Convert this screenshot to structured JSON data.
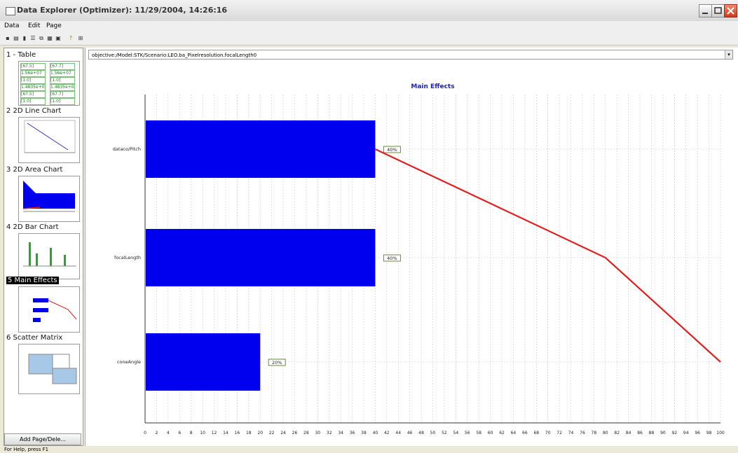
{
  "window": {
    "title": "Data Explorer (Optimizer): 11/29/2004, 14:26:16"
  },
  "menu": [
    "Data",
    "Edit",
    "Page"
  ],
  "toolbar": {
    "icons": [
      "save-icon",
      "print-icon",
      "export-icon",
      "table-icon",
      "copy-icon",
      "chart-icon",
      "settings-icon",
      "help-icon",
      "pin-icon"
    ]
  },
  "sidebar": {
    "pages": [
      {
        "label": "1 - Table",
        "thumb": "table"
      },
      {
        "label": "2  2D Line Chart",
        "thumb": "line"
      },
      {
        "label": "3  2D Area Chart",
        "thumb": "area"
      },
      {
        "label": "4  2D Bar Chart",
        "thumb": "bar"
      },
      {
        "label": "5  Main Effects",
        "thumb": "maineffects",
        "selected": true
      },
      {
        "label": "6  Scatter Matrix",
        "thumb": "scatter"
      }
    ],
    "table_thumb_cells": [
      "[67.5]",
      "[67.7]",
      "1.56e+07",
      "1.56e+07",
      "[1.0]",
      "[1.0]",
      "1.4835e+01",
      "1.4835e+01",
      "[67.5]",
      "[67.7]",
      "[1.0]",
      "[1.0]",
      "[1.0]",
      "[1.0]"
    ],
    "add_page_label": "Add Page/Dele..."
  },
  "objective": {
    "text": "objective:/Model:STK/Scenario:LEO.ba_Pixelresolution.focalLength0"
  },
  "chart_data": {
    "type": "bar",
    "orientation": "horizontal",
    "title": "Main Effects",
    "categories": [
      "dataco/Pitch",
      "focalLength",
      "coneAngle"
    ],
    "values": [
      40,
      40,
      20
    ],
    "value_labels": [
      "40%",
      "40%",
      "20%"
    ],
    "cumulative_line": [
      40,
      80,
      100
    ],
    "xlim": [
      0,
      100
    ],
    "xticks": [
      0,
      2,
      4,
      6,
      8,
      10,
      12,
      14,
      16,
      18,
      20,
      22,
      24,
      26,
      28,
      30,
      32,
      34,
      36,
      38,
      40,
      42,
      44,
      46,
      48,
      50,
      52,
      54,
      56,
      58,
      60,
      62,
      64,
      66,
      68,
      70,
      72,
      74,
      76,
      78,
      80,
      82,
      84,
      86,
      88,
      90,
      92,
      94,
      96,
      98,
      100
    ],
    "grid": true,
    "colors": {
      "bar": "#0000ee",
      "line": "#e02020",
      "title": "#2020c0",
      "label_border": "#6a8a3a"
    }
  },
  "statusbar": {
    "text": "For Help, press F1"
  }
}
